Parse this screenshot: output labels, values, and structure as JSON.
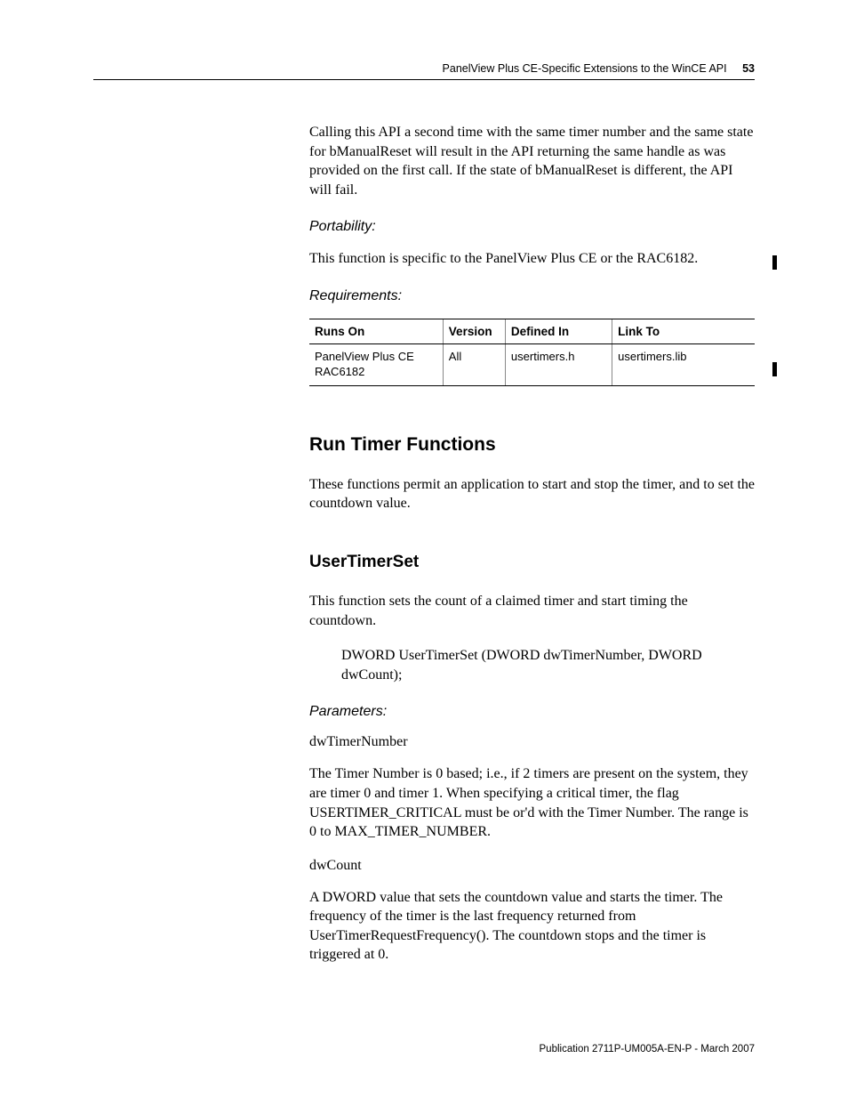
{
  "header": {
    "title": "PanelView Plus CE-Specific Extensions to the WinCE API",
    "page_number": "53"
  },
  "para_intro": "Calling this API a second time with the same timer number and the same state for bManualReset will result in the API returning the same handle as was provided on the first call. If the state of bManualReset is different, the API will fail.",
  "portability": {
    "heading": "Portability:",
    "text": "This function is specific to the PanelView Plus CE or the RAC6182."
  },
  "requirements": {
    "heading": "Requirements:",
    "columns": [
      "Runs On",
      "Version",
      "Defined In",
      "Link To"
    ],
    "row": {
      "runs_on": "PanelView Plus CE RAC6182",
      "version": "All",
      "defined_in": "usertimers.h",
      "link_to": "usertimers.lib"
    }
  },
  "run_timer": {
    "heading": "Run Timer Functions",
    "text": "These functions permit an application to start and stop the timer, and to set the countdown value."
  },
  "usertimerset": {
    "heading": "UserTimerSet",
    "intro": "This function sets the count of a claimed timer and start timing the countdown.",
    "signature": "DWORD UserTimerSet (DWORD dwTimerNumber, DWORD dwCount);",
    "parameters_heading": "Parameters:",
    "param1_name": "dwTimerNumber",
    "param1_desc": "The Timer Number is 0 based; i.e., if 2 timers are present on the system, they are timer 0 and timer 1. When specifying a critical timer, the flag USERTIMER_CRITICAL must be or'd with the Timer Number. The range is 0 to MAX_TIMER_NUMBER.",
    "param2_name": "dwCount",
    "param2_desc": "A DWORD value that sets the countdown value and starts the timer. The frequency of the timer is the last frequency returned from UserTimerRequestFrequency(). The countdown stops and the timer is triggered at 0."
  },
  "footer": "Publication 2711P-UM005A-EN-P - March 2007"
}
